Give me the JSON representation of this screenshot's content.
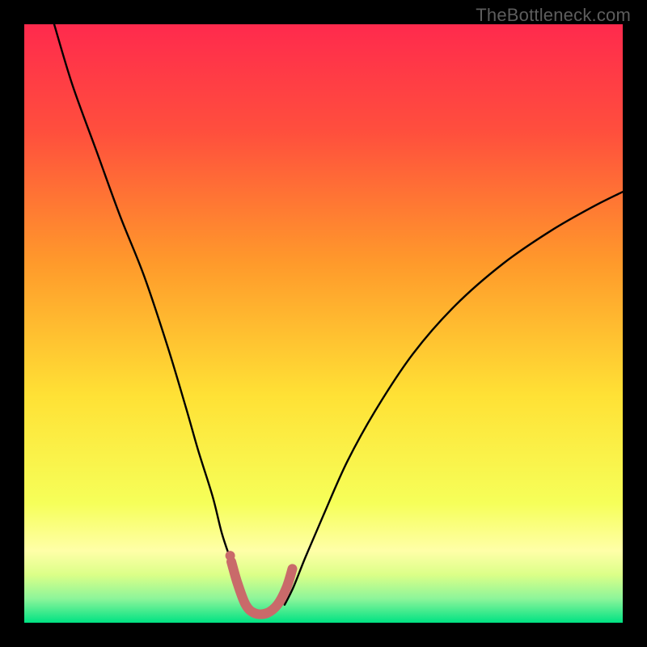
{
  "watermark": "TheBottleneck.com",
  "colors": {
    "page_bg": "#000000",
    "gradient_top": "#ff2a4d",
    "gradient_mid1": "#ff9a2b",
    "gradient_mid2": "#ffe135",
    "gradient_mid3": "#f5ff5a",
    "gradient_mid4": "#b6ff5a",
    "gradient_bottom": "#00e283",
    "curve_stroke": "#000000",
    "marker_stroke": "#c96a6a",
    "marker_dot": "#c96a6a"
  },
  "chart_data": {
    "type": "line",
    "title": "",
    "xlabel": "",
    "ylabel": "",
    "xlim": [
      0,
      100
    ],
    "ylim": [
      0,
      100
    ],
    "grid": false,
    "legend": false,
    "series": [
      {
        "name": "left-branch",
        "x": [
          5,
          8,
          12,
          16,
          20,
          24,
          27,
          29,
          31.5,
          33,
          34.5,
          36,
          37.3
        ],
        "y": [
          100,
          90,
          79,
          68,
          58,
          46,
          36,
          29,
          21,
          15,
          10.5,
          6.3,
          3.0
        ]
      },
      {
        "name": "right-branch",
        "x": [
          43.5,
          45,
          47,
          50,
          54,
          59,
          65,
          72,
          80,
          88,
          95,
          100
        ],
        "y": [
          3.0,
          6.0,
          11,
          18,
          27,
          36,
          45,
          53,
          60,
          65.5,
          69.5,
          72
        ]
      },
      {
        "name": "valley-highlight",
        "x": [
          34.6,
          35.6,
          37.0,
          38.5,
          40.5,
          42.3,
          43.8,
          44.8
        ],
        "y": [
          10.2,
          6.7,
          3.0,
          1.6,
          1.6,
          3.0,
          5.8,
          9.0
        ]
      }
    ],
    "annotations": [
      {
        "type": "dot",
        "x": 34.4,
        "y": 11.2,
        "color": "#c96a6a"
      }
    ],
    "note": "Values are approximate readings off an unlabeled bottleneck-style plot; y is relative height (0 = green baseline, 100 = top of gradient)."
  }
}
